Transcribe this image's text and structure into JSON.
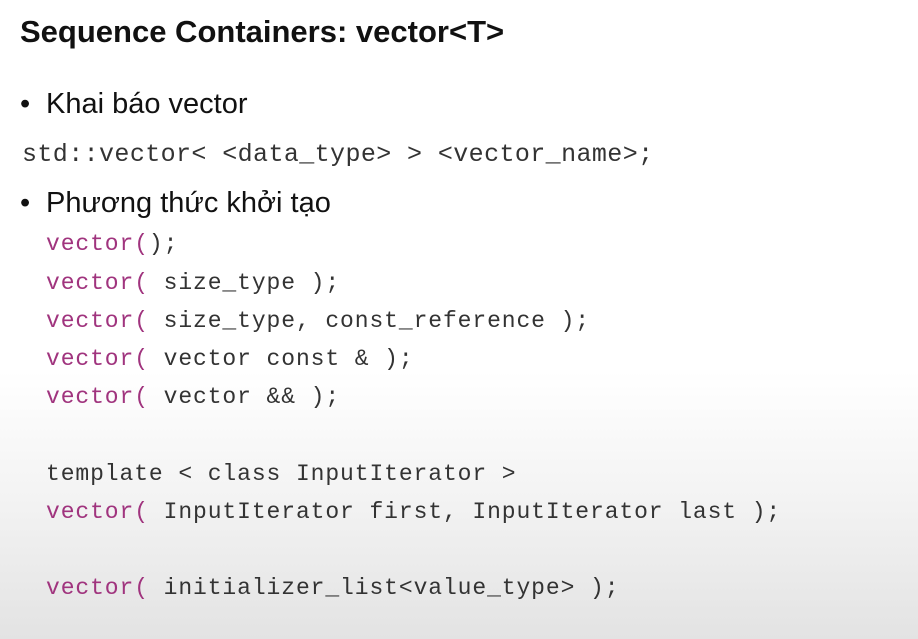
{
  "slide": {
    "title": "Sequence Containers: vector<T>",
    "bullets": [
      {
        "marker": "•",
        "text": "Khai báo vector"
      },
      {
        "marker": "•",
        "text": "Phương thức khởi tạo"
      }
    ],
    "declaration": "std::vector< <data_type> > <vector_name>;",
    "constructors": [
      {
        "name": "vector",
        "open": "(",
        "params": "",
        "close": ");"
      },
      {
        "name": "vector",
        "open": "( ",
        "params": "size_type ",
        "close": ");"
      },
      {
        "name": "vector",
        "open": "( ",
        "params": "size_type, const_reference ",
        "close": ");"
      },
      {
        "name": "vector",
        "open": "( ",
        "params": "vector const & ",
        "close": ");"
      },
      {
        "name": "vector",
        "open": "( ",
        "params": "vector && ",
        "close": ");"
      }
    ],
    "template_line": "template < class InputIterator >",
    "iterator_ctor": {
      "name": "vector",
      "open": "( ",
      "params": "InputIterator first, InputIterator last ",
      "close": ");"
    },
    "init_list_ctor": {
      "name": "vector",
      "open": "( ",
      "params": "initializer_list<value_type> ",
      "close": ");"
    }
  },
  "colors": {
    "keyword": "#a0347e",
    "code_text": "#333333",
    "title": "#111111"
  }
}
